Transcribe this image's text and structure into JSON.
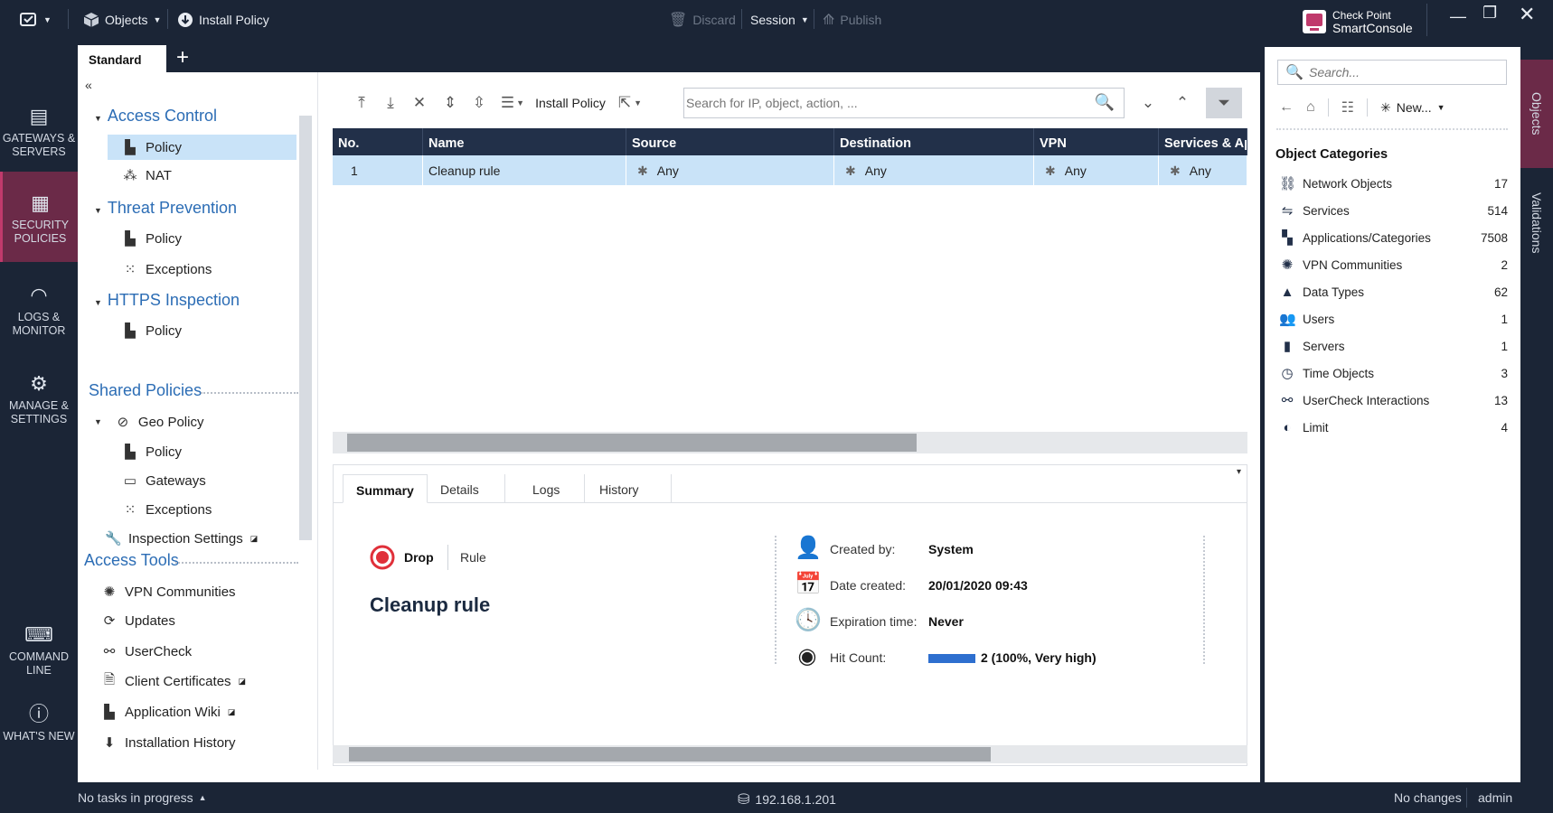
{
  "topbar": {
    "objects_label": "Objects",
    "install_policy_label": "Install Policy",
    "discard_label": "Discard",
    "session_label": "Session",
    "publish_label": "Publish",
    "brand_line1": "Check Point",
    "brand_line2": "SmartConsole"
  },
  "leftnav": {
    "gateways": "GATEWAYS & SERVERS",
    "security": "SECURITY POLICIES",
    "logs": "LOGS & MONITOR",
    "manage": "MANAGE & SETTINGS",
    "command": "COMMAND LINE",
    "whatsnew": "WHAT'S NEW"
  },
  "tabs": {
    "standard": "Standard",
    "add": "+"
  },
  "tree": {
    "collapse": "«",
    "access_control": "Access Control",
    "ac_policy": "Policy",
    "ac_nat": "NAT",
    "threat_prevention": "Threat Prevention",
    "tp_policy": "Policy",
    "tp_exceptions": "Exceptions",
    "https_inspection": "HTTPS Inspection",
    "hi_policy": "Policy",
    "shared_policies": "Shared Policies",
    "geo_policy": "Geo Policy",
    "geo_sub_policy": "Policy",
    "geo_gateways": "Gateways",
    "geo_exceptions": "Exceptions",
    "inspection_settings": "Inspection Settings",
    "access_tools": "Access Tools",
    "vpn_communities": "VPN Communities",
    "updates": "Updates",
    "usercheck": "UserCheck",
    "client_certificates": "Client Certificates",
    "application_wiki": "Application Wiki",
    "installation_history": "Installation History"
  },
  "toolbar": {
    "install_policy": "Install Policy",
    "search_placeholder": "Search for IP, object, action, ..."
  },
  "rule_table": {
    "columns": [
      "No.",
      "Name",
      "Source",
      "Destination",
      "VPN",
      "Services & Ap"
    ],
    "rows": [
      {
        "no": "1",
        "name": "Cleanup rule",
        "source": "Any",
        "destination": "Any",
        "vpn": "Any",
        "services": "Any"
      }
    ]
  },
  "details": {
    "tabs": [
      "Summary",
      "Details",
      "Logs",
      "History"
    ],
    "action": "Drop",
    "type": "Rule",
    "rule_name": "Cleanup rule",
    "created_by_label": "Created by:",
    "created_by": "System",
    "date_created_label": "Date created:",
    "date_created": "20/01/2020 09:43",
    "expiration_label": "Expiration time:",
    "expiration": "Never",
    "hit_count_label": "Hit Count:",
    "hit_count": "2 (100%, Very high)",
    "hit_fraction": 1.0
  },
  "objects_pane": {
    "search_placeholder": "Search...",
    "new_label": "New...",
    "categories_title": "Object Categories",
    "categories": [
      {
        "name": "Network Objects",
        "count": "17"
      },
      {
        "name": "Services",
        "count": "514"
      },
      {
        "name": "Applications/Categories",
        "count": "7508"
      },
      {
        "name": "VPN Communities",
        "count": "2"
      },
      {
        "name": "Data Types",
        "count": "62"
      },
      {
        "name": "Users",
        "count": "1"
      },
      {
        "name": "Servers",
        "count": "1"
      },
      {
        "name": "Time Objects",
        "count": "3"
      },
      {
        "name": "UserCheck Interactions",
        "count": "13"
      },
      {
        "name": "Limit",
        "count": "4"
      }
    ]
  },
  "vstrip": {
    "objects": "Objects",
    "validations": "Validations"
  },
  "statusbar": {
    "tasks": "No tasks in progress",
    "server": "192.168.1.201",
    "changes": "No changes",
    "user": "admin"
  },
  "colors": {
    "accent": "#c03a6c",
    "nav_bg": "#1b2536",
    "header_bg": "#223049",
    "selection": "#c9e3f8",
    "link_blue": "#2c6db5",
    "hit_bar": "#2e6fcf"
  }
}
